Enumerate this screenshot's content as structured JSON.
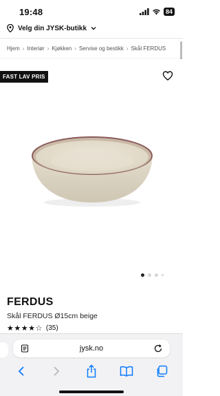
{
  "status_bar": {
    "time": "19:48",
    "battery": "84"
  },
  "store": {
    "label": "Velg din JYSK-butikk"
  },
  "breadcrumb": [
    "Hjem",
    "Interiør",
    "Kjøkken",
    "Servise og bestikk",
    "Skål FERDUS"
  ],
  "badge": "FAST LAV PRIS",
  "product": {
    "title": "FERDUS",
    "subtitle": "Skål FERDUS Ø15cm beige",
    "rating_value": 4,
    "rating_max": 5,
    "review_count": "(35)"
  },
  "carousel": {
    "current": 1,
    "total": 4
  },
  "browser": {
    "url": "jysk.no"
  },
  "icons": {
    "location": "location-pin-icon",
    "chevron": "chevron-down-icon",
    "heart": "heart-icon",
    "reader": "reader-icon",
    "reload": "reload-icon",
    "back": "back-icon",
    "forward": "forward-icon",
    "share": "share-icon",
    "bookmarks": "bookmarks-icon",
    "tabs": "tabs-icon"
  },
  "colors": {
    "accent": "#111111",
    "badge_bg": "#111111",
    "bowl_rim": "#8a5a5a",
    "safari_blue": "#0a7aff"
  }
}
